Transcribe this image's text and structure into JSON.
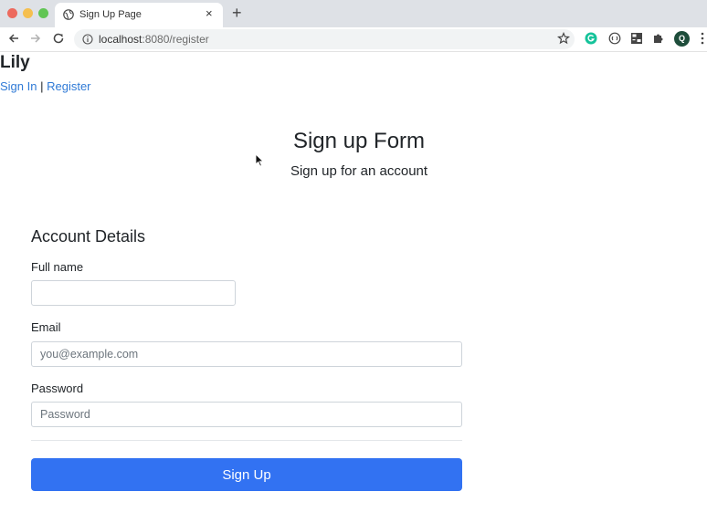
{
  "browser": {
    "tab_title": "Sign Up Page",
    "tab_close": "×",
    "new_tab": "+",
    "url_host": "localhost",
    "url_path": ":8080/register",
    "profile_initial": "Q",
    "colors": {
      "traffic_red": "#ed6a5e",
      "traffic_yellow": "#f5bf4f",
      "traffic_green": "#61c554"
    }
  },
  "header": {
    "brand": "Lily",
    "sign_in_link": "Sign In",
    "separator": " | ",
    "register_link": "Register"
  },
  "form": {
    "title": "Sign up Form",
    "subtitle": "Sign up for an account",
    "section_title": "Account Details",
    "full_name": {
      "label": "Full name",
      "value": "",
      "placeholder": ""
    },
    "email": {
      "label": "Email",
      "value": "",
      "placeholder": "you@example.com"
    },
    "password": {
      "label": "Password",
      "value": "",
      "placeholder": "Password"
    },
    "submit_label": "Sign Up"
  },
  "icons": {
    "back": "back-arrow-icon",
    "forward": "forward-arrow-icon",
    "reload": "reload-icon",
    "info": "info-icon",
    "bookmark": "star-icon",
    "extensions": [
      "grammarly-icon",
      "extension-icon",
      "selenium-icon",
      "puzzle-icon"
    ],
    "menu": "more-vert-icon"
  },
  "accent_color": "#3272f2",
  "link_color": "#2f7ad6"
}
